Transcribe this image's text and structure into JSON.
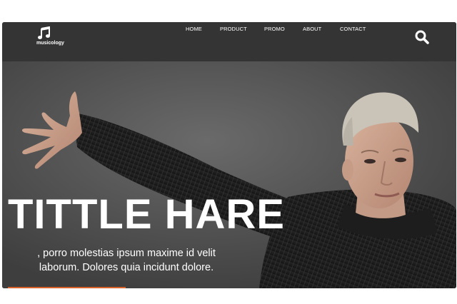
{
  "brand": {
    "name": "musicology",
    "icon": "music-note-icon"
  },
  "nav": {
    "items": [
      {
        "label": "HOME"
      },
      {
        "label": "PRODUCT"
      },
      {
        "label": "PROMO"
      },
      {
        "label": "ABOUT"
      },
      {
        "label": "CONTACT"
      }
    ],
    "search_icon": "search-icon"
  },
  "hero": {
    "title": "TITTLE HARE",
    "subtitle_line1": ", porro molestias ipsum maxime id velit",
    "subtitle_line2": "laborum. Dolores quia incidunt dolore.",
    "image": "man-in-black-sweater-photo"
  },
  "colors": {
    "navbar": "#343434",
    "hero_bg": "#4b4b4b",
    "text": "#ffffff",
    "accent": "#d9622b"
  }
}
